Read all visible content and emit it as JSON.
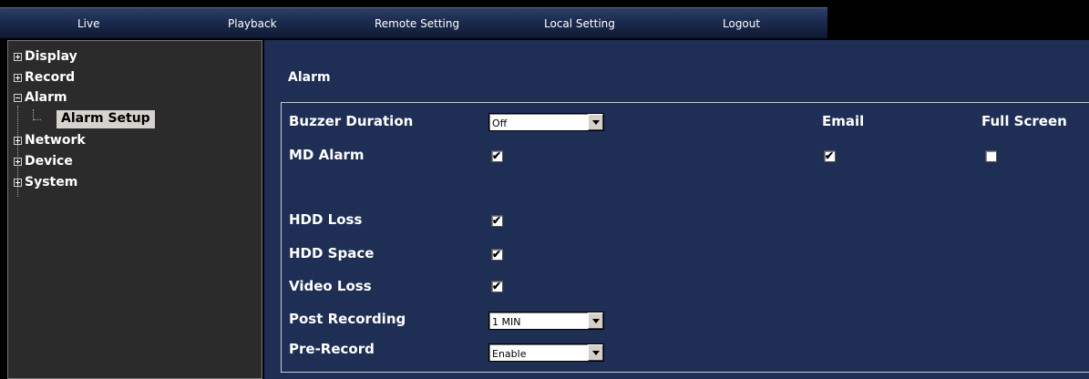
{
  "nav": {
    "items": [
      "Live",
      "Playback",
      "Remote Setting",
      "Local Setting",
      "Logout"
    ]
  },
  "sidebar": {
    "items": [
      {
        "label": "Display",
        "expanded": false
      },
      {
        "label": "Record",
        "expanded": false
      },
      {
        "label": "Alarm",
        "expanded": true
      },
      {
        "label": "Network",
        "expanded": false
      },
      {
        "label": "Device",
        "expanded": false
      },
      {
        "label": "System",
        "expanded": false
      }
    ],
    "selected_child": "Alarm Setup"
  },
  "panel": {
    "title": "Alarm",
    "columns": {
      "email": "Email",
      "full_screen": "Full Screen"
    },
    "buzzer_duration": {
      "label": "Buzzer Duration",
      "value": "Off"
    },
    "md_alarm": {
      "label": "MD Alarm",
      "checked": true,
      "email": true,
      "full_screen": false
    },
    "hdd_loss": {
      "label": "HDD Loss",
      "checked": true
    },
    "hdd_space": {
      "label": "HDD Space",
      "checked": true
    },
    "video_loss": {
      "label": "Video Loss",
      "checked": true
    },
    "post_recording": {
      "label": "Post Recording",
      "value": "1 MIN"
    },
    "pre_record": {
      "label": "Pre-Record",
      "value": "Enable"
    }
  },
  "colors": {
    "panel_bg": "#1e2e55",
    "sidebar_bg": "#2b2b2b",
    "selected_bg": "#d6d3ce"
  }
}
